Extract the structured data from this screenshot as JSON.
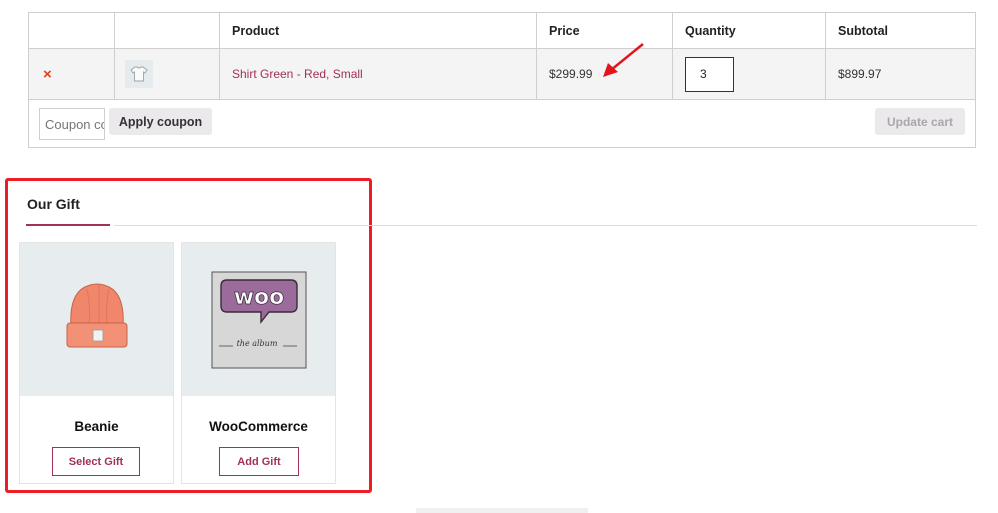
{
  "cart": {
    "headers": [
      "",
      "",
      "Product",
      "Price",
      "Quantity",
      "Subtotal"
    ],
    "row": {
      "remove_symbol": "×",
      "product_name": "Shirt Green - Red, Small",
      "price": "$299.99",
      "quantity": "3",
      "subtotal": "$899.97"
    },
    "coupon_placeholder": "Coupon code",
    "apply_label": "Apply coupon",
    "update_label": "Update cart"
  },
  "gift": {
    "title": "Our Gift",
    "items": [
      {
        "name": "Beanie",
        "button": "Select Gift",
        "icon": "beanie-image"
      },
      {
        "name": "WooCommerce",
        "button": "Add Gift",
        "icon": "woo-album-image",
        "logo_text": "woo",
        "album_text": "the album"
      }
    ]
  },
  "colors": {
    "accent": "#a33055",
    "highlight": "#ee1c25",
    "remove": "#e2401c"
  }
}
